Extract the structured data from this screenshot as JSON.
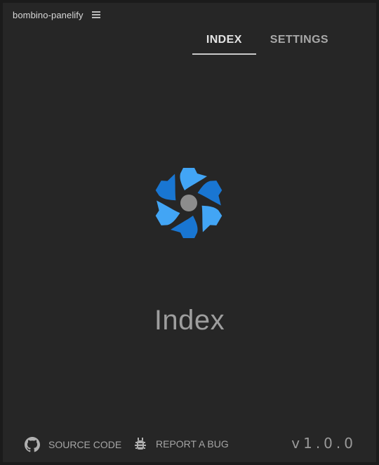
{
  "panel": {
    "title": "bombino-panelify",
    "menu_icon": "hamburger-menu-icon"
  },
  "tabs": [
    {
      "label": "INDEX",
      "active": true
    },
    {
      "label": "SETTINGS",
      "active": false
    }
  ],
  "main": {
    "logo_icon": "quasar-logo-icon",
    "heading": "Index"
  },
  "footer": {
    "source_code": {
      "label": "SOURCE CODE",
      "icon": "github-icon"
    },
    "report_bug": {
      "label": "REPORT A BUG",
      "icon": "bug-icon"
    },
    "version": "v1.0.0"
  },
  "colors": {
    "background": "#262626",
    "logo_blue_light": "#42a5f5",
    "logo_blue_dark": "#1976d2",
    "logo_center": "#8c8c8c"
  }
}
